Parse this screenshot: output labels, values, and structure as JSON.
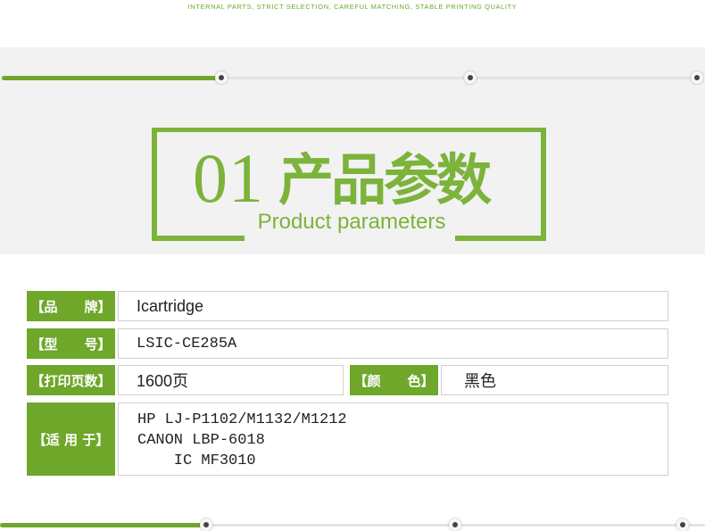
{
  "header": {
    "tagline": "INTERNAL PARTS, STRICT SELECTION, CAREFUL MATCHING, STABLE PRINTING QUALITY"
  },
  "section": {
    "number": "01",
    "title_cn": "产品参数",
    "title_en": "Product parameters"
  },
  "progress": {
    "top_fraction": 0.31,
    "bottom_fraction": 0.28
  },
  "colors": {
    "accent": "#6ea72a",
    "frame": "#7cb33a",
    "band": "#f2f2f2",
    "border": "#cfcfcf"
  },
  "params": {
    "brand": {
      "label": "【品　　牌】",
      "value": "Icartridge"
    },
    "model": {
      "label": "【型　　号】",
      "value": "LSIC-CE285A"
    },
    "pages": {
      "label": "【打印页数】",
      "value": "1600页"
    },
    "color": {
      "label": "【颜　　色】",
      "value": "黑色"
    },
    "fit": {
      "label": "【适 用 于】",
      "lines": [
        "HP LJ-P1102/M1132/M1212",
        "CANON LBP-6018",
        "    IC MF3010"
      ]
    }
  }
}
